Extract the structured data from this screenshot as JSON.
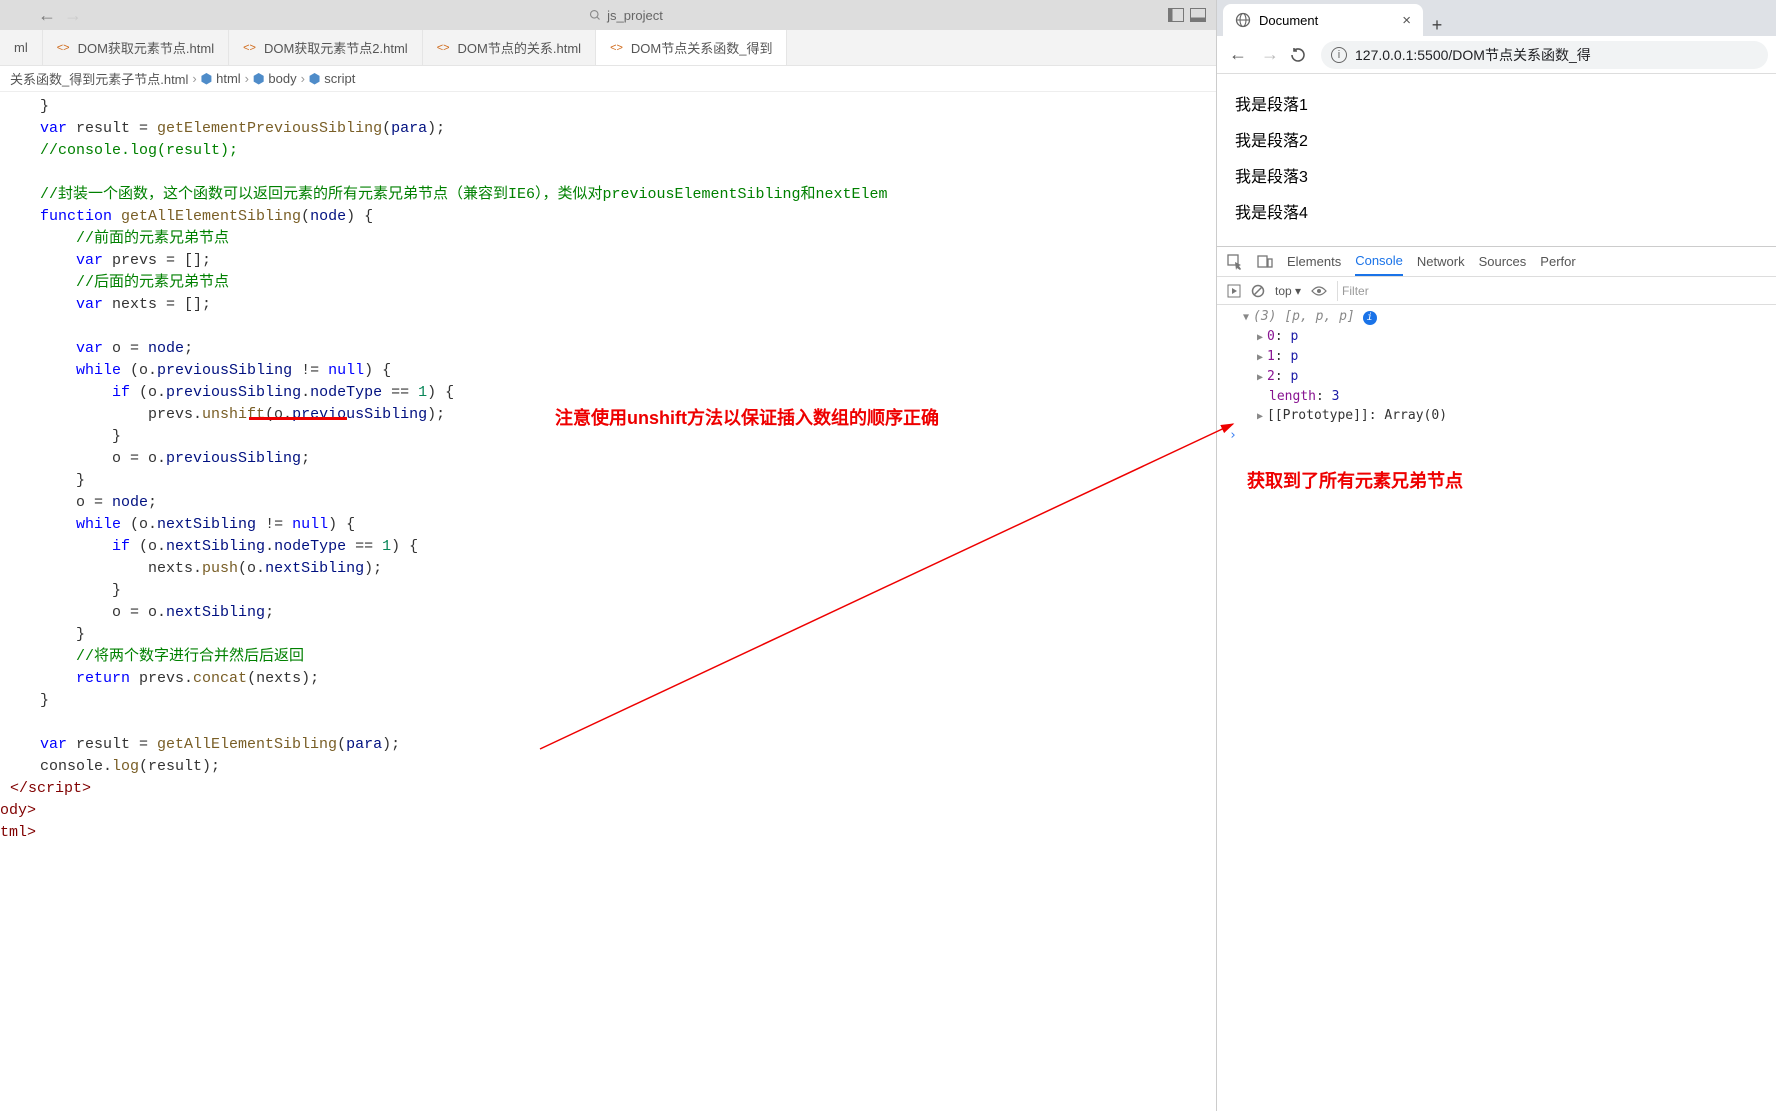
{
  "titlebar": {
    "project": "js_project"
  },
  "tabs": [
    {
      "label": "ml"
    },
    {
      "label": "DOM获取元素节点.html"
    },
    {
      "label": "DOM获取元素节点2.html"
    },
    {
      "label": "DOM节点的关系.html"
    },
    {
      "label": "DOM节点关系函数_得到",
      "active": true
    }
  ],
  "breadcrumb": {
    "file": "关系函数_得到元素子节点.html",
    "path": [
      "html",
      "body",
      "script"
    ]
  },
  "code": {
    "l1": "}",
    "l2_var": "var",
    "l2_name": " result = ",
    "l2_fn": "getElementPreviousSibling",
    "l2_arg": "para",
    "l3": "//console.log(result);",
    "l5_c": "//封装一个函数，这个函数可以返回元素的所有元素兄弟节点（兼容到IE6），类似对previousElementSibling和nextElem",
    "l6_fn": "function ",
    "l6_name": "getAllElementSibling",
    "l6_param": "node",
    "l7": "//前面的元素兄弟节点",
    "l8": "var",
    "l8b": " prevs = [];",
    "l9": "//后面的元素兄弟节点",
    "l10": "var",
    "l10b": " nexts = [];",
    "l12": "var",
    "l12b": " o = ",
    "l12c": "node",
    "l13_while": "while",
    "l13_prop": "previousSibling",
    "l13_null": "null",
    "l14_if": "if",
    "l14_nt": "nodeType",
    "l14_one": "1",
    "l15_un": "unshift",
    "l16": "}",
    "l17": "o = o.",
    "l17b": "previousSibling",
    "l18": "}",
    "l19": "o = ",
    "l19b": "node",
    "l20_ns": "nextSibling",
    "l22_push": "push",
    "l25": "//将两个数字进行合并然后后返回",
    "l26_ret": "return",
    "l26_concat": "concat",
    "l29_fn": "getAllElementSibling",
    "l30_log": "log",
    "scriptend": "</script",
    "bodyend": "ody>",
    "htmlend": "tml>"
  },
  "annotations": {
    "a1": "注意使用unshift方法以保证插入数组的顺序正确",
    "a2": "获取到了所有元素兄弟节点"
  },
  "browser": {
    "tab": "Document",
    "url": "127.0.0.1:5500/DOM节点关系函数_得",
    "content": [
      "我是段落1",
      "我是段落2",
      "我是段落3",
      "我是段落4"
    ]
  },
  "devtools": {
    "tabs": [
      "Elements",
      "Console",
      "Network",
      "Sources",
      "Perfor"
    ],
    "bar_top": "top",
    "bar_filter": "Filter",
    "console": {
      "head": "(3) ",
      "head2": "[p, p, p]",
      "rows": [
        {
          "k": "0",
          "v": "p"
        },
        {
          "k": "1",
          "v": "p"
        },
        {
          "k": "2",
          "v": "p"
        }
      ],
      "len_k": "length",
      "len_v": "3",
      "proto": "[[Prototype]]",
      "proto_v": "Array(0)"
    }
  }
}
